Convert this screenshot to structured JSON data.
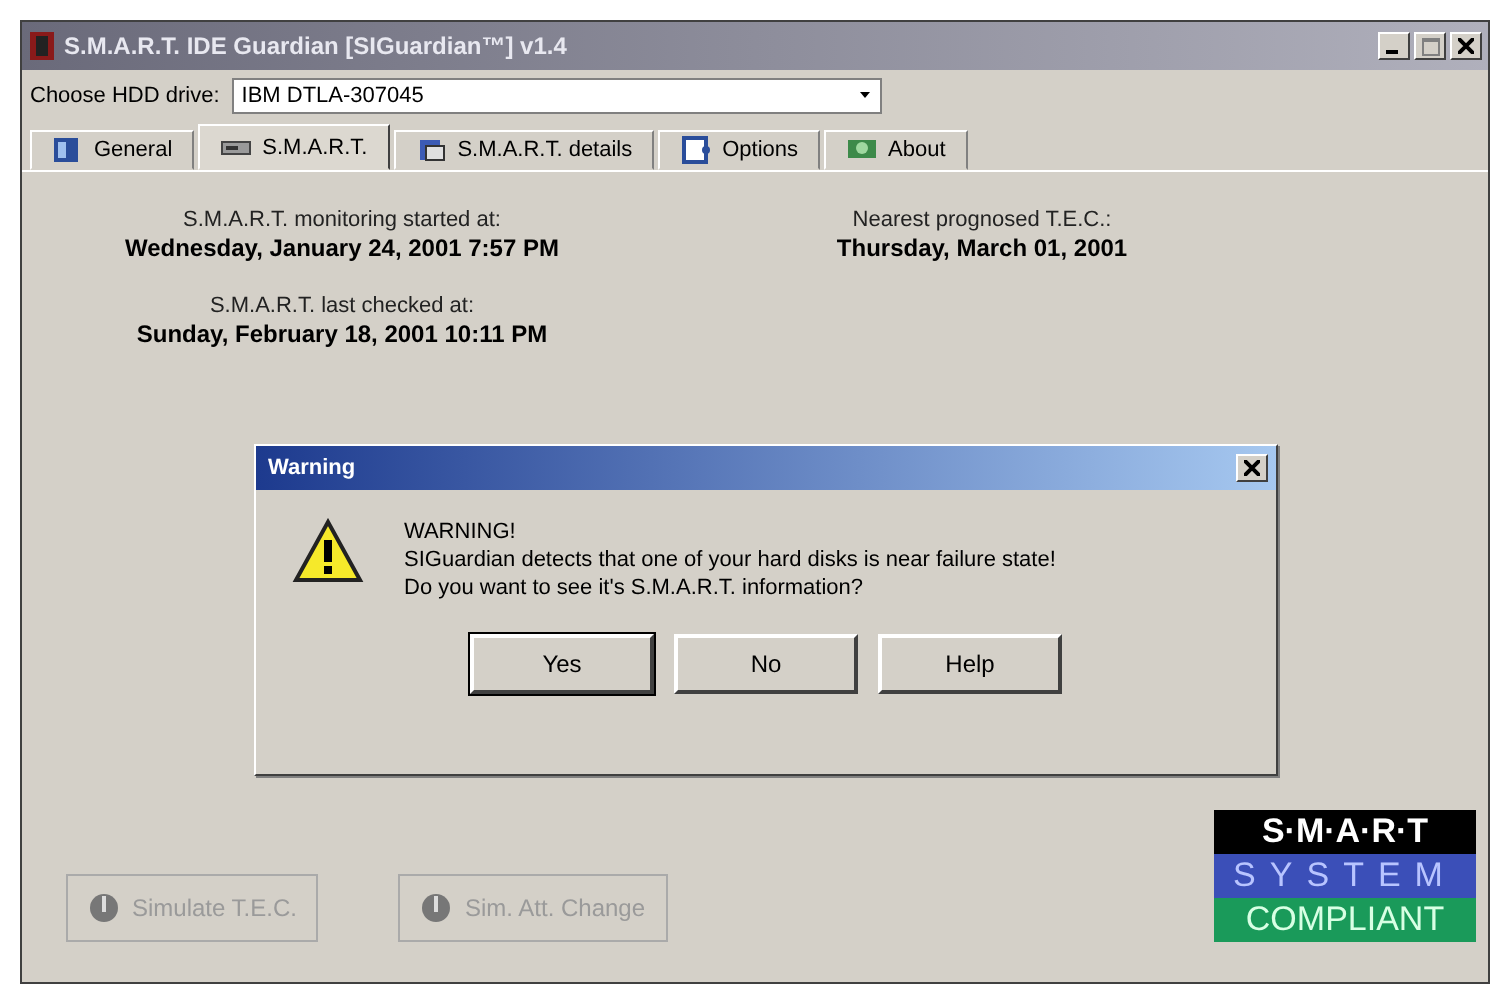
{
  "window": {
    "title": "S.M.A.R.T. IDE Guardian [SIGuardian™] v1.4"
  },
  "drive": {
    "label": "Choose HDD drive:",
    "value": "IBM DTLA-307045"
  },
  "tabs": [
    {
      "label": "General",
      "selected": false
    },
    {
      "label": "S.M.A.R.T.",
      "selected": true
    },
    {
      "label": "S.M.A.R.T. details",
      "selected": false
    },
    {
      "label": "Options",
      "selected": false
    },
    {
      "label": "About",
      "selected": false
    }
  ],
  "info": [
    {
      "label": "S.M.A.R.T. monitoring started at:",
      "value": "Wednesday, January 24, 2001 7:57 PM"
    },
    {
      "label": "Nearest prognosed T.E.C.:",
      "value": "Thursday, March 01, 2001"
    },
    {
      "label": "S.M.A.R.T. last checked at:",
      "value": "Sunday, February 18, 2001 10:11 PM"
    }
  ],
  "actions": [
    {
      "label": "Simulate T.E.C.",
      "disabled": true
    },
    {
      "label": "Sim. Att. Change",
      "disabled": true
    }
  ],
  "logo": [
    "S·M·A·R·T",
    "SYSTEM",
    "COMPLIANT"
  ],
  "dialog": {
    "title": "Warning",
    "heading": "WARNING!",
    "lines": [
      "SIGuardian detects that one of your hard disks is near failure state!",
      "Do you want to see it's S.M.A.R.T. information?"
    ],
    "buttons": [
      {
        "label": "Yes",
        "default": true
      },
      {
        "label": "No",
        "default": false
      },
      {
        "label": "Help",
        "default": false
      }
    ]
  }
}
